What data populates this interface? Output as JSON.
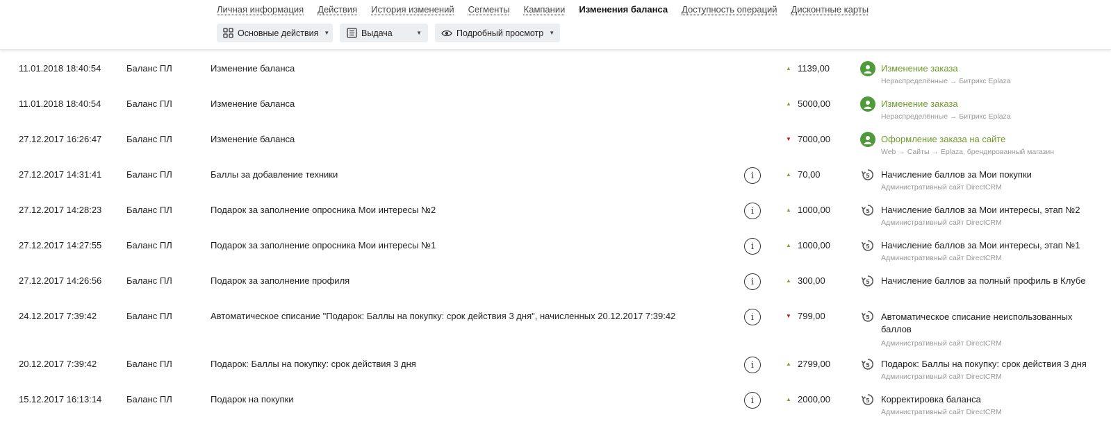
{
  "tabs": [
    {
      "label": "Личная информация",
      "active": false
    },
    {
      "label": "Действия",
      "active": false
    },
    {
      "label": "История изменений",
      "active": false
    },
    {
      "label": "Сегменты",
      "active": false
    },
    {
      "label": "Кампании",
      "active": false
    },
    {
      "label": "Изменения баланса",
      "active": true
    },
    {
      "label": "Доступность операций",
      "active": false
    },
    {
      "label": "Дисконтные карты",
      "active": false
    }
  ],
  "controls": {
    "main_actions": {
      "label": "Основные действия",
      "icon": "grid-icon"
    },
    "issue": {
      "label": "Выдача",
      "icon": "list-icon"
    },
    "detailed_view": {
      "label": "Подробный просмотр",
      "icon": "eye-icon"
    }
  },
  "colors": {
    "up": "#7fa23c",
    "down": "#b71c1c",
    "source_green": "#6f9a2c",
    "avatar_green": "#4f9a3a"
  },
  "rows": [
    {
      "date": "11.01.2018 18:40:54",
      "balance": "Баланс ПЛ",
      "description": "Изменение баланса",
      "has_info": false,
      "direction": "up",
      "amount": "1139,00",
      "source_icon": "user-avatar-icon",
      "source_title": "Изменение заказа",
      "source_title_green": true,
      "source_sub": "Нераспределённые → Битрикс Eplaza"
    },
    {
      "date": "11.01.2018 18:40:54",
      "balance": "Баланс ПЛ",
      "description": "Изменение баланса",
      "has_info": false,
      "direction": "up",
      "amount": "5000,00",
      "source_icon": "user-avatar-icon",
      "source_title": "Изменение заказа",
      "source_title_green": true,
      "source_sub": "Нераспределённые → Битрикс Eplaza"
    },
    {
      "date": "27.12.2017 16:26:47",
      "balance": "Баланс ПЛ",
      "description": "Изменение баланса",
      "has_info": false,
      "direction": "down",
      "amount": "7000,00",
      "source_icon": "user-avatar-icon",
      "source_title": "Оформление заказа на сайте",
      "source_title_green": true,
      "source_sub": "Web → Сайты → Eplaza, брендированный магазин"
    },
    {
      "date": "27.12.2017 14:31:41",
      "balance": "Баланс ПЛ",
      "description": "Баллы за добавление техники",
      "has_info": true,
      "direction": "up",
      "amount": "70,00",
      "source_icon": "points-icon",
      "source_title": "Начисление баллов за Мои покупки",
      "source_title_green": false,
      "source_sub": "Административный сайт DirectCRM"
    },
    {
      "date": "27.12.2017 14:28:23",
      "balance": "Баланс ПЛ",
      "description": "Подарок за заполнение опросника Мои интересы №2",
      "has_info": true,
      "direction": "up",
      "amount": "1000,00",
      "source_icon": "points-icon",
      "source_title": "Начисление баллов за Мои интересы, этап №2",
      "source_title_green": false,
      "source_sub": "Административный сайт DirectCRM"
    },
    {
      "date": "27.12.2017 14:27:55",
      "balance": "Баланс ПЛ",
      "description": "Подарок за заполнение опросника Мои интересы №1",
      "has_info": true,
      "direction": "up",
      "amount": "1000,00",
      "source_icon": "points-icon",
      "source_title": "Начисление баллов за Мои интересы, этап №1",
      "source_title_green": false,
      "source_sub": "Административный сайт DirectCRM"
    },
    {
      "date": "27.12.2017 14:26:56",
      "balance": "Баланс ПЛ",
      "description": "Подарок за заполнение профиля",
      "has_info": true,
      "direction": "up",
      "amount": "300,00",
      "source_icon": "points-icon",
      "source_title": "Начисление баллов за полный профиль в Клубе",
      "source_title_green": false,
      "source_sub": ""
    },
    {
      "date": "24.12.2017 7:39:42",
      "balance": "Баланс ПЛ",
      "description": "Автоматическое списание \"Подарок: Баллы на покупку: срок действия 3 дня\", начисленных 20.12.2017 7:39:42",
      "has_info": true,
      "direction": "down",
      "amount": "799,00",
      "source_icon": "points-icon",
      "source_title": "Автоматическое списание неиспользованных баллов",
      "source_title_green": false,
      "source_sub": "Административный сайт DirectCRM"
    },
    {
      "date": "20.12.2017 7:39:42",
      "balance": "Баланс ПЛ",
      "description": "Подарок: Баллы на покупку: срок действия 3 дня",
      "has_info": true,
      "direction": "up",
      "amount": "2799,00",
      "source_icon": "points-icon",
      "source_title": "Подарок: Баллы на покупку: срок действия 3 дня",
      "source_title_green": false,
      "source_sub": "Административный сайт DirectCRM"
    },
    {
      "date": "15.12.2017 16:13:14",
      "balance": "Баланс ПЛ",
      "description": "Подарок на покупки",
      "has_info": true,
      "direction": "up",
      "amount": "2000,00",
      "source_icon": "points-icon",
      "source_title": "Корректировка баланса",
      "source_title_green": false,
      "source_sub": "Административный сайт DirectCRM"
    }
  ]
}
